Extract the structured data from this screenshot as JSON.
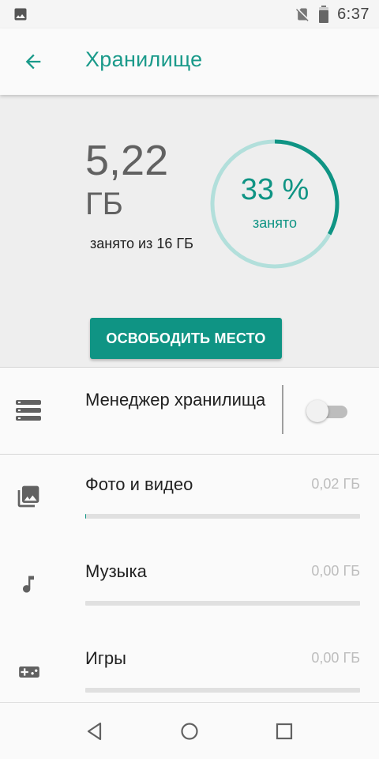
{
  "status_bar": {
    "time": "6:37",
    "icons": [
      "image-icon",
      "no-sim-icon",
      "battery-icon"
    ]
  },
  "app_bar": {
    "title": "Хранилище",
    "back_icon": "arrow-back-icon"
  },
  "summary": {
    "used_value": "5,22",
    "used_unit": "ГБ",
    "used_caption": "занято из 16 ГБ",
    "percent_label": "33 %",
    "percent_value": 33,
    "percent_caption": "занято",
    "free_button": "ОСВОБОДИТЬ МЕСТО"
  },
  "storage_manager": {
    "label": "Менеджер хранилища",
    "icon": "storage-icon",
    "enabled": false
  },
  "categories": [
    {
      "label": "Фото и видео",
      "size": "0,02 ГБ",
      "icon": "photo-library-icon",
      "fraction": 0.001
    },
    {
      "label": "Музыка",
      "size": "0,00 ГБ",
      "icon": "music-note-icon",
      "fraction": 0
    },
    {
      "label": "Игры",
      "size": "0,00 ГБ",
      "icon": "gamepad-icon",
      "fraction": 0
    }
  ],
  "nav_bar": {
    "icons": [
      "back-triangle-icon",
      "home-circle-icon",
      "recents-square-icon"
    ]
  },
  "colors": {
    "accent": "#0f9484",
    "ring_track": "#b2dfdb",
    "header_bg": "#eeeeee"
  }
}
